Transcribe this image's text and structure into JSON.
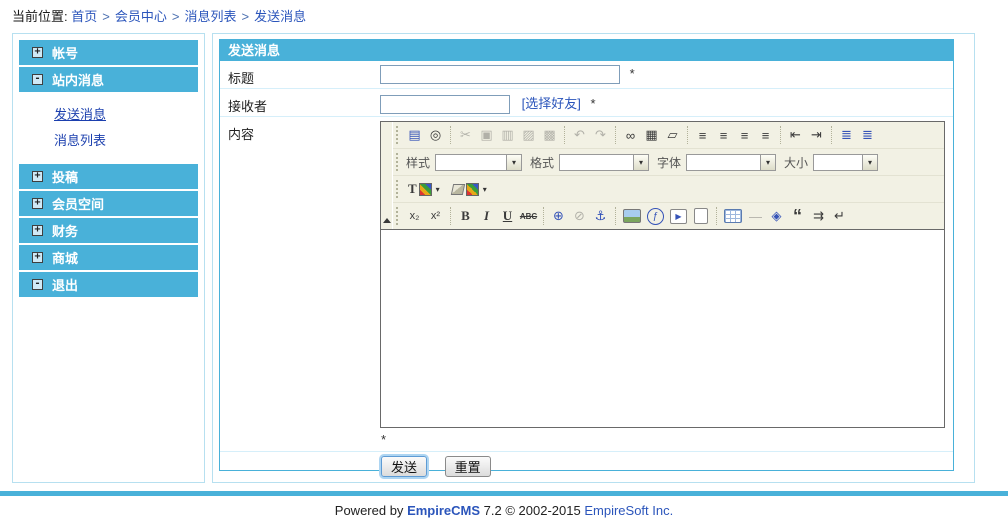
{
  "breadcrumb": {
    "label": "当前位置:",
    "separator": ">",
    "items": [
      "首页",
      "会员中心",
      "消息列表",
      "发送消息"
    ]
  },
  "sidebar": {
    "items": [
      {
        "label": "帐号",
        "icon": "plus"
      },
      {
        "label": "站内消息",
        "icon": "minus"
      },
      {
        "label": "投稿",
        "icon": "plus"
      },
      {
        "label": "会员空间",
        "icon": "plus"
      },
      {
        "label": "财务",
        "icon": "plus"
      },
      {
        "label": "商城",
        "icon": "plus"
      },
      {
        "label": "退出",
        "icon": "minus"
      }
    ],
    "submenu": [
      {
        "label": "发送消息",
        "current": true
      },
      {
        "label": "消息列表",
        "current": false
      }
    ]
  },
  "panel": {
    "title": "发送消息",
    "title_label": "标题",
    "title_value": "",
    "receiver_label": "接收者",
    "receiver_value": "",
    "choose_friends_link": "[选择好友]",
    "content_label": "内容",
    "required_mark": "*",
    "content_required_mark": "*",
    "send_label": "发送",
    "reset_label": "重置"
  },
  "editor": {
    "style_label": "样式",
    "format_label": "格式",
    "font_label": "字体",
    "size_label": "大小",
    "text_color_glyph": "T",
    "toolbar_row1": [
      {
        "name": "source-button",
        "glyph": "▤",
        "cls": "cb"
      },
      {
        "name": "preview-button",
        "glyph": "◎",
        "cls": "cd"
      },
      {
        "name": "toolbar-separator",
        "sep": true
      },
      {
        "name": "cut-button",
        "glyph": "✂",
        "cls": "cd dis"
      },
      {
        "name": "copy-button",
        "glyph": "▣",
        "cls": "cd dis"
      },
      {
        "name": "paste-button",
        "glyph": "▥",
        "cls": "cd dis"
      },
      {
        "name": "paste-text-button",
        "glyph": "▨",
        "cls": "cd dis"
      },
      {
        "name": "paste-word-button",
        "glyph": "▩",
        "cls": "cd dis"
      },
      {
        "name": "toolbar-separator",
        "sep": true
      },
      {
        "name": "undo-button",
        "glyph": "↶",
        "cls": "cd dis"
      },
      {
        "name": "redo-button",
        "glyph": "↷",
        "cls": "cd dis"
      },
      {
        "name": "toolbar-separator",
        "sep": true
      },
      {
        "name": "find-button",
        "glyph": "∞",
        "cls": "cd"
      },
      {
        "name": "select-all-button",
        "glyph": "▦",
        "cls": "cd"
      },
      {
        "name": "remove-format-button",
        "glyph": "▱",
        "cls": "cd"
      },
      {
        "name": "toolbar-separator",
        "sep": true
      },
      {
        "name": "align-left-button",
        "glyph": "≡",
        "cls": "cd"
      },
      {
        "name": "align-center-button",
        "glyph": "≡",
        "cls": "cd"
      },
      {
        "name": "align-right-button",
        "glyph": "≡",
        "cls": "cd"
      },
      {
        "name": "justify-button",
        "glyph": "≡",
        "cls": "cd"
      },
      {
        "name": "toolbar-separator",
        "sep": true
      },
      {
        "name": "outdent-button",
        "glyph": "⇤",
        "cls": "cd"
      },
      {
        "name": "indent-button",
        "glyph": "⇥",
        "cls": "cd"
      },
      {
        "name": "toolbar-separator",
        "sep": true
      },
      {
        "name": "ordered-list-button",
        "glyph": "≣",
        "cls": "cb"
      },
      {
        "name": "bullet-list-button",
        "glyph": "≣",
        "cls": "cb"
      }
    ],
    "toolbar_row4": [
      {
        "name": "subscript-button",
        "glyph": "x₂",
        "cls": "cd sm"
      },
      {
        "name": "superscript-button",
        "glyph": "x²",
        "cls": "cd sm"
      },
      {
        "name": "toolbar-separator",
        "sep": true
      },
      {
        "name": "bold-button",
        "glyph": "B",
        "cls": "cd b"
      },
      {
        "name": "italic-button",
        "glyph": "I",
        "cls": "cd i"
      },
      {
        "name": "underline-button",
        "glyph": "U",
        "cls": "cd u"
      },
      {
        "name": "strikethrough-button",
        "glyph": "ABC",
        "cls": "cd s xs"
      },
      {
        "name": "toolbar-separator",
        "sep": true
      },
      {
        "name": "link-button",
        "glyph": "⊕",
        "cls": "cb"
      },
      {
        "name": "unlink-button",
        "glyph": "⊘",
        "cls": "cd dis"
      },
      {
        "name": "anchor-button",
        "glyph": "⚓",
        "cls": "cb"
      },
      {
        "name": "toolbar-separator",
        "sep": true
      },
      {
        "name": "image-button",
        "glyph": "",
        "cls": "img-ico"
      },
      {
        "name": "flash-button",
        "glyph": "ƒ",
        "cls": "cb ring"
      },
      {
        "name": "media-button",
        "glyph": "▶",
        "cls": "cb boxed"
      },
      {
        "name": "new-page-button",
        "glyph": "",
        "cls": "page-ico"
      },
      {
        "name": "toolbar-separator",
        "sep": true
      },
      {
        "name": "table-button",
        "glyph": "",
        "cls": "table-ico"
      },
      {
        "name": "horizontal-rule-button",
        "glyph": "—",
        "cls": "cd dis"
      },
      {
        "name": "widget-button",
        "glyph": "◈",
        "cls": "cb"
      },
      {
        "name": "blockquote-button",
        "glyph": "“",
        "cls": "cd bq"
      },
      {
        "name": "template-button",
        "glyph": "⇉",
        "cls": "cd"
      },
      {
        "name": "line-break-button",
        "glyph": "↵",
        "cls": "cd"
      }
    ]
  },
  "footer": {
    "powered_by": "Powered by",
    "product": "EmpireCMS",
    "version": "7.2",
    "copyright": "© 2002-2015",
    "company": "EmpireSoft Inc."
  },
  "colors": {
    "accent": "#49b1d9",
    "panel_border": "#b7e0f0",
    "row_divider": "#d6effa",
    "link": "#2b55bb",
    "toolbar_bg": "#f2f1e4",
    "editor_border": "#696969",
    "required_mark": "#333333"
  }
}
